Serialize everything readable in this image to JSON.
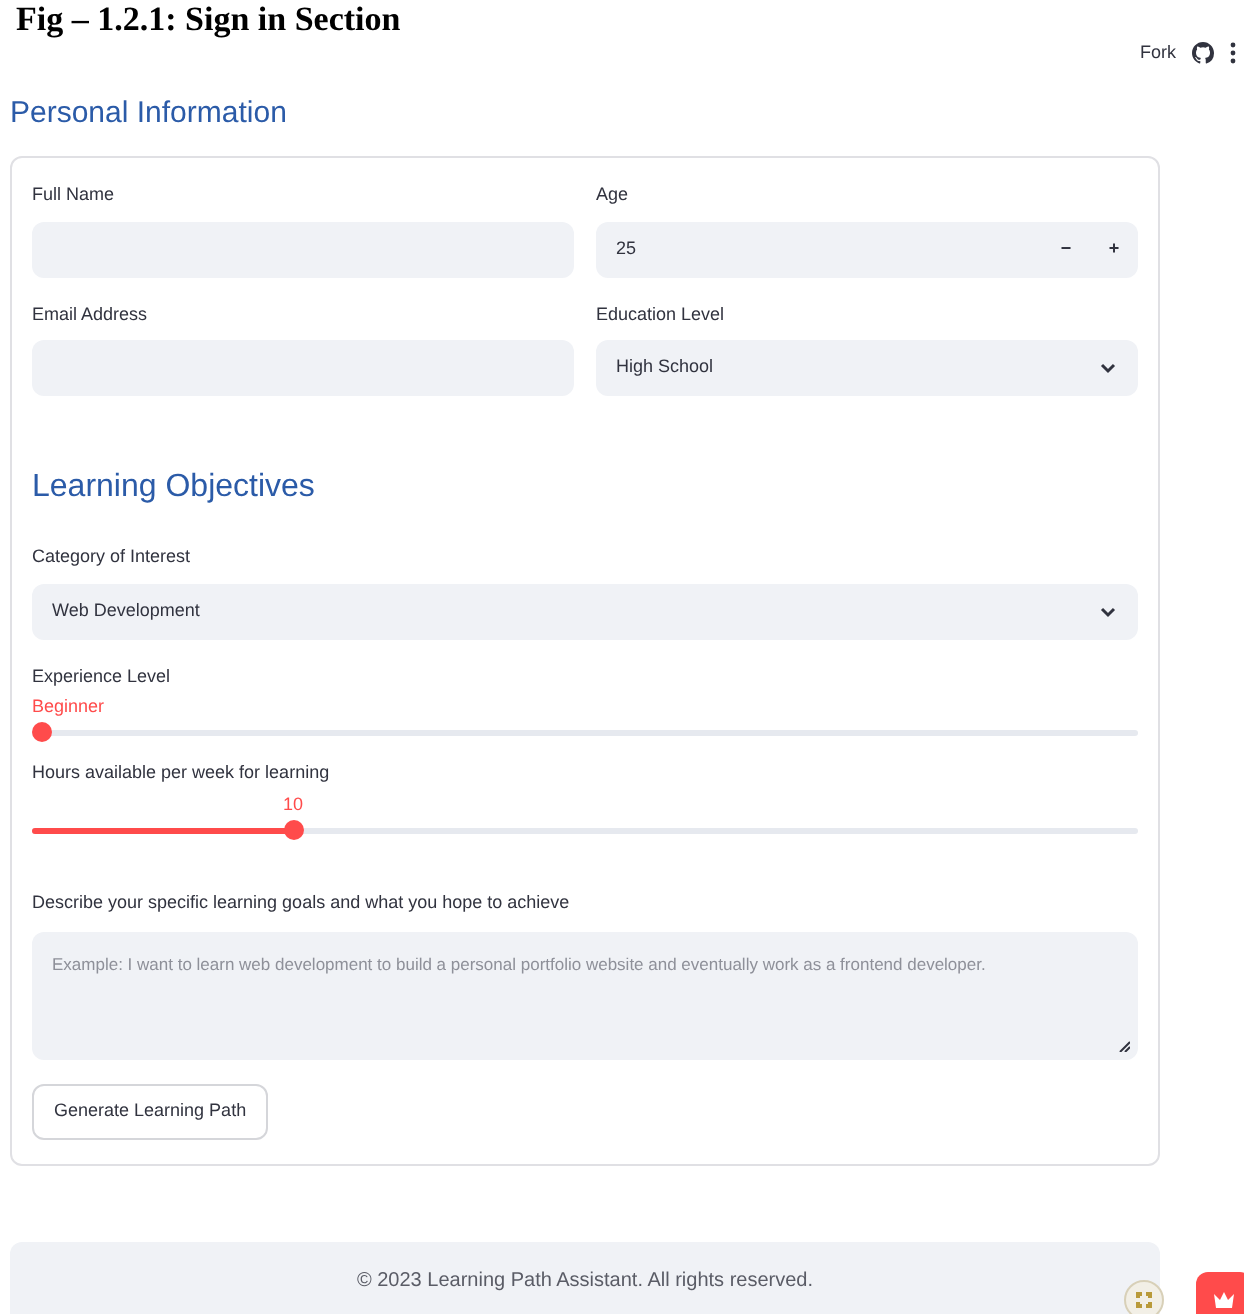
{
  "caption": "Fig – 1.2.1: Sign in Section",
  "header": {
    "fork": "Fork"
  },
  "personal": {
    "title": "Personal Information",
    "fields": [
      {
        "kind": "text",
        "label": "Full Name"
      },
      {
        "kind": "number",
        "label": "Age",
        "value": "25",
        "minus": "−",
        "plus": "+"
      },
      {
        "kind": "text",
        "label": "Email Address"
      },
      {
        "kind": "select",
        "label": "Education Level",
        "value": "High School"
      }
    ]
  },
  "objectives": {
    "title": "Learning Objectives",
    "category": {
      "label": "Category of Interest",
      "value": "Web Development"
    },
    "sliders": [
      {
        "label": "Experience Level",
        "reading": "Beginner",
        "level": 0
      },
      {
        "label": "Hours available per week for learning",
        "reading": "10",
        "level": 0.236
      }
    ],
    "goals": {
      "label": "Describe your specific learning goals and what you hope to achieve",
      "placeholder": "Example: I want to learn web development to build a personal portfolio website and eventually work as a frontend developer."
    },
    "button": "Generate Learning Path"
  },
  "footer": "© 2023 Learning Path Assistant. All rights reserved."
}
